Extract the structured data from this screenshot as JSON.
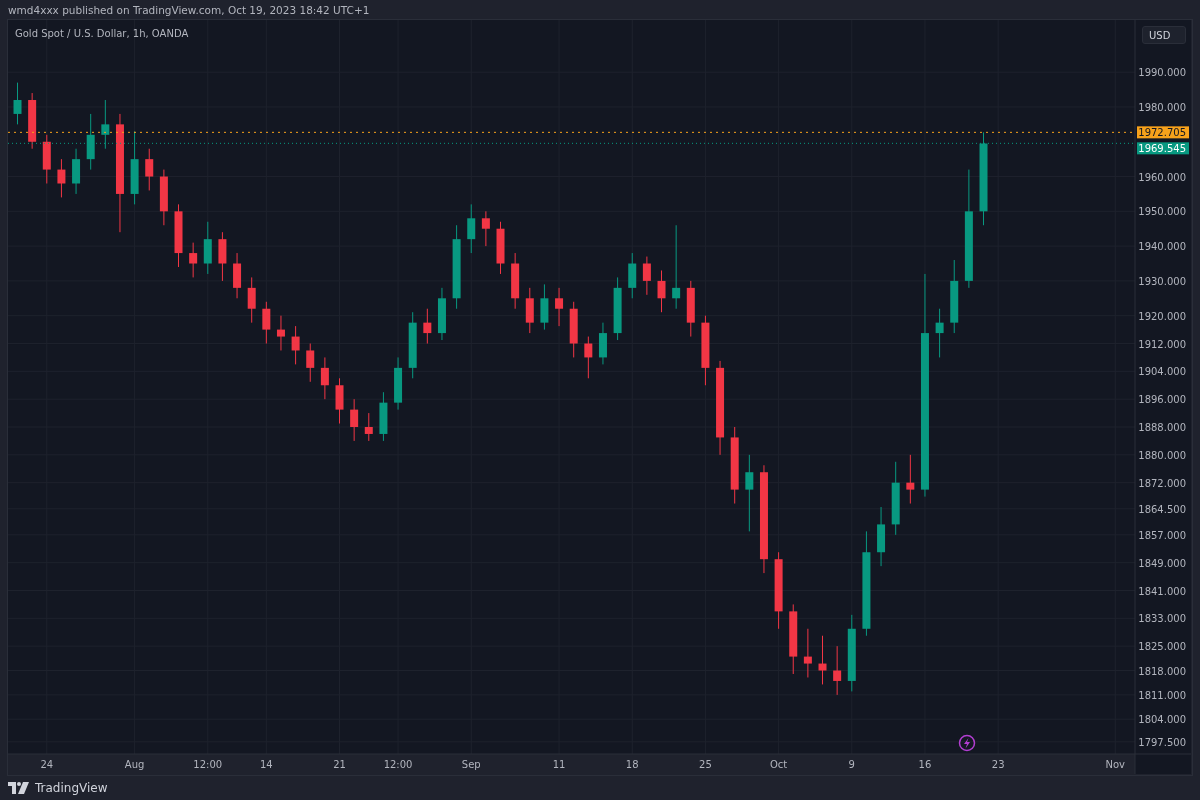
{
  "header": {
    "text": "wmd4xxx published on TradingView.com, Oct 19, 2023 18:42 UTC+1"
  },
  "chart": {
    "title": "Gold Spot / U.S. Dollar, 1h, OANDA",
    "currency_button": "USD",
    "chart_data": {
      "type": "candlestick",
      "grid": true,
      "ylim": [
        1794,
        2005
      ],
      "categories": [
        null,
        null,
        "24",
        null,
        null,
        null,
        null,
        null,
        "Aug",
        null,
        null,
        null,
        null,
        "12:00",
        null,
        null,
        null,
        "14",
        null,
        null,
        null,
        null,
        "21",
        null,
        null,
        null,
        "12:00",
        null,
        null,
        null,
        null,
        "Sep",
        null,
        null,
        null,
        null,
        null,
        "11",
        null,
        null,
        null,
        null,
        "18",
        null,
        null,
        null,
        null,
        "25",
        null,
        null,
        null,
        null,
        "Oct",
        null,
        null,
        null,
        null,
        "9",
        null,
        null,
        null,
        null,
        "16",
        null,
        null,
        null,
        null,
        "23",
        null,
        null,
        null,
        null,
        null,
        null,
        null,
        "Nov",
        null
      ],
      "ohlc": [
        [
          1978,
          1987,
          1975,
          1982
        ],
        [
          1982,
          1984,
          1968,
          1970
        ],
        [
          1970,
          1972,
          1958,
          1962
        ],
        [
          1962,
          1965,
          1954,
          1958
        ],
        [
          1958,
          1968,
          1955,
          1965
        ],
        [
          1965,
          1978,
          1962,
          1972
        ],
        [
          1972,
          1982,
          1968,
          1975
        ],
        [
          1975,
          1978,
          1944,
          1955
        ],
        [
          1955,
          1973,
          1952,
          1965
        ],
        [
          1965,
          1968,
          1956,
          1960
        ],
        [
          1960,
          1962,
          1946,
          1950
        ],
        [
          1950,
          1952,
          1934,
          1938
        ],
        [
          1938,
          1941,
          1931,
          1935
        ],
        [
          1935,
          1947,
          1932,
          1942
        ],
        [
          1942,
          1944,
          1930,
          1935
        ],
        [
          1935,
          1938,
          1925,
          1928
        ],
        [
          1928,
          1931,
          1918,
          1922
        ],
        [
          1922,
          1924,
          1912,
          1916
        ],
        [
          1916,
          1920,
          1910,
          1914
        ],
        [
          1914,
          1917,
          1906,
          1910
        ],
        [
          1910,
          1912,
          1901,
          1905
        ],
        [
          1905,
          1908,
          1896,
          1900
        ],
        [
          1900,
          1902,
          1889,
          1893
        ],
        [
          1893,
          1896,
          1884,
          1888
        ],
        [
          1888,
          1892,
          1884,
          1886
        ],
        [
          1886,
          1898,
          1884,
          1895
        ],
        [
          1895,
          1908,
          1893,
          1905
        ],
        [
          1905,
          1921,
          1902,
          1918
        ],
        [
          1918,
          1922,
          1912,
          1915
        ],
        [
          1915,
          1928,
          1913,
          1925
        ],
        [
          1925,
          1946,
          1922,
          1942
        ],
        [
          1942,
          1952,
          1938,
          1948
        ],
        [
          1948,
          1950,
          1940,
          1945
        ],
        [
          1945,
          1947,
          1932,
          1935
        ],
        [
          1935,
          1938,
          1922,
          1925
        ],
        [
          1925,
          1928,
          1915,
          1918
        ],
        [
          1918,
          1929,
          1916,
          1925
        ],
        [
          1925,
          1928,
          1917,
          1922
        ],
        [
          1922,
          1924,
          1908,
          1912
        ],
        [
          1912,
          1914,
          1902,
          1908
        ],
        [
          1908,
          1918,
          1906,
          1915
        ],
        [
          1915,
          1931,
          1913,
          1928
        ],
        [
          1928,
          1938,
          1925,
          1935
        ],
        [
          1935,
          1937,
          1926,
          1930
        ],
        [
          1930,
          1933,
          1921,
          1925
        ],
        [
          1925,
          1946,
          1922,
          1928
        ],
        [
          1928,
          1930,
          1914,
          1918
        ],
        [
          1918,
          1920,
          1900,
          1905
        ],
        [
          1905,
          1907,
          1880,
          1885
        ],
        [
          1885,
          1888,
          1866,
          1870
        ],
        [
          1870,
          1880,
          1858,
          1875
        ],
        [
          1875,
          1877,
          1846,
          1850
        ],
        [
          1850,
          1852,
          1830,
          1835
        ],
        [
          1835,
          1837,
          1817,
          1822
        ],
        [
          1822,
          1830,
          1816,
          1820
        ],
        [
          1820,
          1828,
          1814,
          1818
        ],
        [
          1818,
          1825,
          1811,
          1815
        ],
        [
          1815,
          1834,
          1812,
          1830
        ],
        [
          1830,
          1858,
          1828,
          1852
        ],
        [
          1852,
          1865,
          1848,
          1860
        ],
        [
          1860,
          1878,
          1857,
          1872
        ],
        [
          1872,
          1880,
          1866,
          1870
        ],
        [
          1870,
          1932,
          1868,
          1915
        ],
        [
          1915,
          1922,
          1908,
          1918
        ],
        [
          1918,
          1936,
          1915,
          1930
        ],
        [
          1930,
          1962,
          1928,
          1950
        ],
        [
          1950,
          1972.7,
          1946,
          1969.5
        ],
        null,
        null,
        null,
        null,
        null,
        null,
        null,
        null,
        null,
        null
      ],
      "yticks": [
        {
          "value": 1990,
          "label": "1990.000"
        },
        {
          "value": 1980,
          "label": "1980.000"
        },
        {
          "value": 1960,
          "label": "1960.000"
        },
        {
          "value": 1950,
          "label": "1950.000"
        },
        {
          "value": 1940,
          "label": "1940.000"
        },
        {
          "value": 1930,
          "label": "1930.000"
        },
        {
          "value": 1920,
          "label": "1920.000"
        },
        {
          "value": 1912,
          "label": "1912.000"
        },
        {
          "value": 1904,
          "label": "1904.000"
        },
        {
          "value": 1896,
          "label": "1896.000"
        },
        {
          "value": 1888,
          "label": "1888.000"
        },
        {
          "value": 1880,
          "label": "1880.000"
        },
        {
          "value": 1872,
          "label": "1872.000"
        },
        {
          "value": 1864.5,
          "label": "1864.500"
        },
        {
          "value": 1857,
          "label": "1857.000"
        },
        {
          "value": 1849,
          "label": "1849.000"
        },
        {
          "value": 1841,
          "label": "1841.000"
        },
        {
          "value": 1833,
          "label": "1833.000"
        },
        {
          "value": 1825,
          "label": "1825.000"
        },
        {
          "value": 1818,
          "label": "1818.000"
        },
        {
          "value": 1811,
          "label": "1811.000"
        },
        {
          "value": 1804,
          "label": "1804.000"
        },
        {
          "value": 1797.5,
          "label": "1797.500"
        }
      ],
      "ref_lines": [
        {
          "axis": "y",
          "value": 1972.705,
          "label": "1972.705",
          "color": "#f7a21b"
        },
        {
          "axis": "y",
          "value": 1969.545,
          "label": "1969.545",
          "color": "#089981"
        }
      ]
    }
  },
  "footer": {
    "brand": "TradingView"
  }
}
